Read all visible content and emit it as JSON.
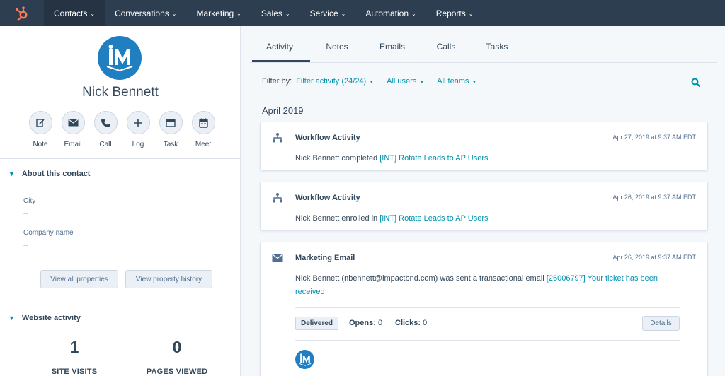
{
  "nav": {
    "items": [
      {
        "label": "Contacts"
      },
      {
        "label": "Conversations"
      },
      {
        "label": "Marketing"
      },
      {
        "label": "Sales"
      },
      {
        "label": "Service"
      },
      {
        "label": "Automation"
      },
      {
        "label": "Reports"
      }
    ],
    "active_index": 0
  },
  "contact": {
    "name": "Nick Bennett",
    "avatar_text": "iM"
  },
  "actions": [
    {
      "label": "Note",
      "icon": "pencil-icon"
    },
    {
      "label": "Email",
      "icon": "envelope-icon"
    },
    {
      "label": "Call",
      "icon": "phone-icon"
    },
    {
      "label": "Log",
      "icon": "plus-icon"
    },
    {
      "label": "Task",
      "icon": "task-icon"
    },
    {
      "label": "Meet",
      "icon": "calendar-icon"
    }
  ],
  "about": {
    "heading": "About this contact",
    "properties": [
      {
        "label": "City",
        "value": "--"
      },
      {
        "label": "Company name",
        "value": "--"
      }
    ],
    "view_all_label": "View all properties",
    "view_history_label": "View property history"
  },
  "website": {
    "heading": "Website activity",
    "site_visits": "1",
    "site_visits_label": "SITE VISITS",
    "pages_viewed": "0",
    "pages_viewed_label": "PAGES VIEWED"
  },
  "tabs": [
    {
      "label": "Activity"
    },
    {
      "label": "Notes"
    },
    {
      "label": "Emails"
    },
    {
      "label": "Calls"
    },
    {
      "label": "Tasks"
    }
  ],
  "filter": {
    "label": "Filter by:",
    "activity": "Filter activity (24/24)",
    "users": "All users",
    "teams": "All teams"
  },
  "month": "April 2019",
  "cards": [
    {
      "icon": "workflow-icon",
      "title": "Workflow Activity",
      "time": "Apr 27, 2019 at 9:37 AM EDT",
      "text": "Nick Bennett completed ",
      "link": "[INT] Rotate Leads to AP Users"
    },
    {
      "icon": "workflow-icon",
      "title": "Workflow Activity",
      "time": "Apr 26, 2019 at 9:37 AM EDT",
      "text": "Nick Bennett enrolled in ",
      "link": "[INT] Rotate Leads to AP Users"
    },
    {
      "icon": "envelope-icon",
      "title": "Marketing Email",
      "time": "Apr 26, 2019 at 9:37 AM EDT",
      "text": "Nick Bennett (nbennett@impactbnd.com) was sent a transactional email ",
      "link": "[26006797] Your ticket has been received",
      "status": "Delivered",
      "opens_label": "Opens:",
      "opens": "0",
      "clicks_label": "Clicks:",
      "clicks": "0",
      "details_label": "Details"
    }
  ],
  "colors": {
    "nav_bg": "#2d3e50",
    "accent": "#0091ae",
    "logo": "#ff7a59",
    "avatar": "#1f7fc1"
  }
}
